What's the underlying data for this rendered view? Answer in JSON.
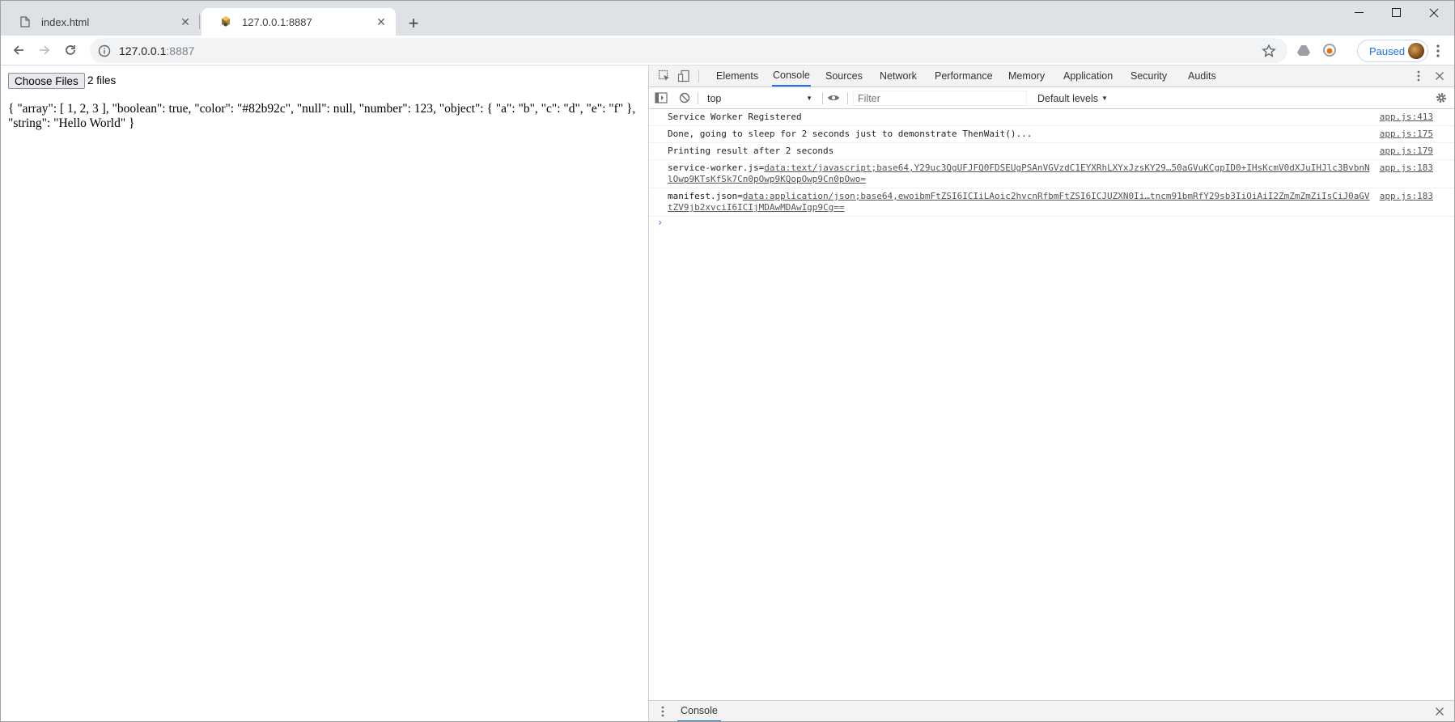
{
  "browser": {
    "tabs": [
      {
        "title": "index.html",
        "icon": "file-icon",
        "active": false
      },
      {
        "title": "127.0.0.1:8887",
        "icon": "web-server-icon",
        "active": true
      }
    ],
    "url_host": "127.0.0.1",
    "url_port": ":8887",
    "profile_status": "Paused"
  },
  "page": {
    "file_button_label": "Choose Files",
    "file_count": "2 files",
    "json_output": "{ \"array\": [ 1, 2, 3 ], \"boolean\": true, \"color\": \"#82b92c\", \"null\": null, \"number\": 123, \"object\": { \"a\": \"b\", \"c\": \"d\", \"e\": \"f\" }, \"string\": \"Hello World\" }"
  },
  "devtools": {
    "tabs": [
      "Elements",
      "Console",
      "Sources",
      "Network",
      "Performance",
      "Memory",
      "Application",
      "Security",
      "Audits"
    ],
    "active_tab": "Console",
    "context": "top",
    "filter_placeholder": "Filter",
    "levels": "Default levels",
    "messages": [
      {
        "text": "Service Worker Registered",
        "source": "app.js:413"
      },
      {
        "text": "Done, going to sleep for 2 seconds just to demonstrate ThenWait()...",
        "source": "app.js:175"
      },
      {
        "text": "Printing result after 2 seconds",
        "source": "app.js:179"
      },
      {
        "prefix": "service-worker.js=",
        "link": "data:text/javascript;base64,Y29uc3QgUFJFQ0FDSEUgPSAnVGVzdC1EYXRhLXYxJzsKY29…50aGVuKCgpID0+IHsKcmV0dXJuIHJlc3BvbnNlOwp9KTsKfSk7Cn0pOwp9KQopOwp9Cn0pOwo=",
        "source": "app.js:183"
      },
      {
        "prefix": "manifest.json=",
        "link": "data:application/json;base64,ewoibmFtZSI6ICIiLAoic2hvcnRfbmFtZSI6ICJUZXN0Ii…tncm91bmRfY29sb3IiOiAiI2ZmZmZmZiIsCiJ0aGVtZV9jb2xvciI6ICIjMDAwMDAwIgp9Cg==",
        "source": "app.js:183"
      }
    ],
    "drawer_tab": "Console"
  }
}
